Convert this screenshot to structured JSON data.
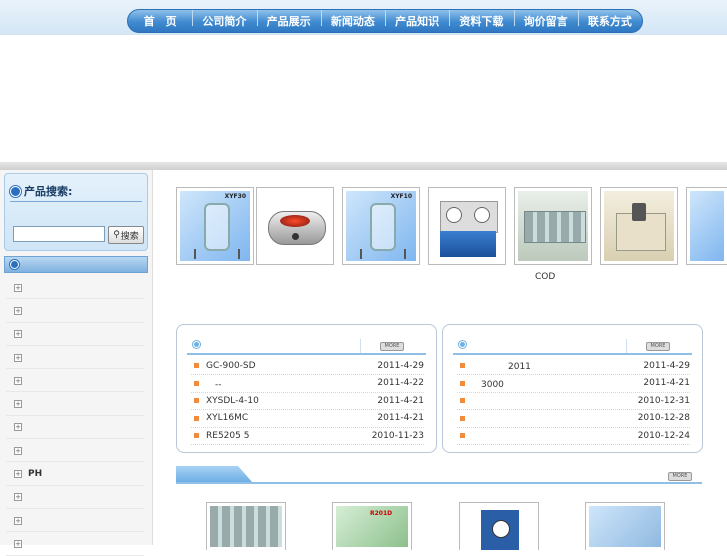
{
  "nav": {
    "items": [
      "首　页",
      "公司简介",
      "产品展示",
      "新闻动态",
      "产品知识",
      "资料下载",
      "询价留言",
      "联系方式"
    ]
  },
  "sidebar": {
    "search_title": "产品搜索:",
    "search_value": "",
    "search_button": "搜索",
    "categories": [
      "",
      "",
      "",
      "",
      "",
      "",
      "",
      "",
      "PH",
      "",
      "",
      ""
    ]
  },
  "products": {
    "items": [
      {
        "label": "XYF30",
        "caption": ""
      },
      {
        "label": "",
        "caption": ""
      },
      {
        "label": "XYF10",
        "caption": ""
      },
      {
        "label": "",
        "caption": ""
      },
      {
        "label": "",
        "caption": "COD"
      },
      {
        "label": "",
        "caption": ""
      },
      {
        "label": "",
        "caption": ""
      }
    ]
  },
  "news_left": {
    "more": "MORE",
    "rows": [
      {
        "title": "GC-900-SD",
        "date": "2011-4-29"
      },
      {
        "title": "　--",
        "date": "2011-4-22"
      },
      {
        "title": "XYSDL-4-10",
        "date": "2011-4-21"
      },
      {
        "title": "XYL16MC",
        "date": "2011-4-21"
      },
      {
        "title": "RE5205 5",
        "date": "2010-11-23"
      }
    ]
  },
  "news_right": {
    "more": "MORE",
    "rows": [
      {
        "title": "　　　　2011",
        "date": "2011-4-29"
      },
      {
        "title": "　3000",
        "date": "2011-4-21"
      },
      {
        "title": "",
        "date": "2010-12-31"
      },
      {
        "title": "",
        "date": "2010-12-28"
      },
      {
        "title": "",
        "date": "2010-12-24"
      }
    ]
  },
  "lower": {
    "more": "MORE",
    "thumbs": [
      {
        "label": ""
      },
      {
        "label": "R201D"
      },
      {
        "label": ""
      },
      {
        "label": ""
      }
    ]
  },
  "colors": {
    "nav_blue": "#3f8ad0",
    "panel_border": "#b8c6d6",
    "bullet_orange": "#f08c3c"
  }
}
